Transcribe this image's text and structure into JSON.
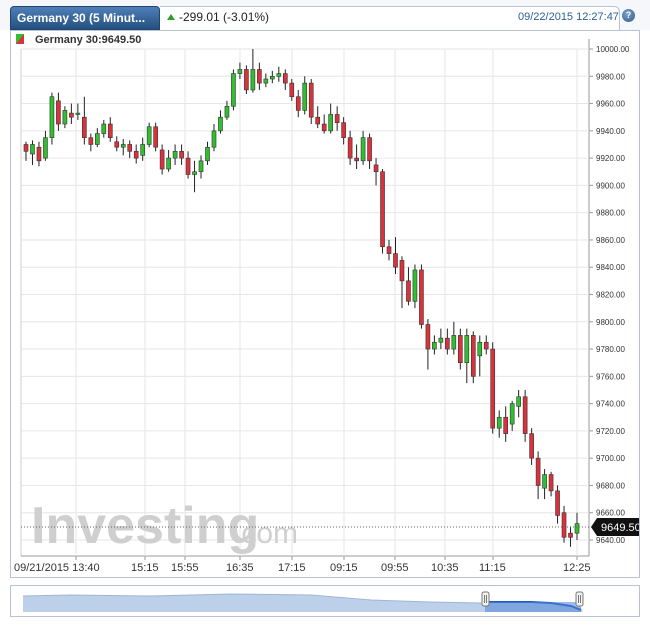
{
  "header": {
    "tab_title": "Germany 30 (5 Minut...",
    "change": "-299.01 (-3.01%)",
    "datetime": "09/22/2015 12:27:47",
    "help_icon": "help-icon"
  },
  "chart": {
    "legend_label": "Germany 30:9649.50",
    "watermark_main": "Investing",
    "watermark_suffix": ".com",
    "last_price_label": "9649.50"
  },
  "colors": {
    "up": "#2fbf2f",
    "down": "#d9323c",
    "tab_bg": "#2d5c8f",
    "grid": "#e6e6e6",
    "nav_fill": "#bcd0ea",
    "nav_line": "#1f5fbf"
  },
  "chart_data": {
    "type": "candlestick",
    "title": "Germany 30 (5 Minut...",
    "ylim": [
      9630,
      10010
    ],
    "y_ticks": [
      "10000.00",
      "9980.00",
      "9960.00",
      "9940.00",
      "9920.00",
      "9900.00",
      "9880.00",
      "9860.00",
      "9840.00",
      "9820.00",
      "9800.00",
      "9780.00",
      "9760.00",
      "9740.00",
      "9720.00",
      "9700.00",
      "9680.00",
      "9660.00",
      "9640.00"
    ],
    "x_ticks": [
      "09/21/2015 13:40",
      "15:15",
      "15:55",
      "16:35",
      "17:15",
      "09:15",
      "09:55",
      "10:35",
      "11:15",
      "12:25"
    ],
    "last_price": 9649.5,
    "candles": [
      [
        9930,
        9925,
        9932,
        9918
      ],
      [
        9923,
        9930,
        9933,
        9915
      ],
      [
        9928,
        9918,
        9932,
        9914
      ],
      [
        9920,
        9935,
        9940,
        9918
      ],
      [
        9935,
        9965,
        9968,
        9930
      ],
      [
        9962,
        9945,
        9968,
        9940
      ],
      [
        9945,
        9955,
        9958,
        9942
      ],
      [
        9953,
        9950,
        9960,
        9945
      ],
      [
        9952,
        9953,
        9960,
        9948
      ],
      [
        9950,
        9935,
        9965,
        9930
      ],
      [
        9935,
        9930,
        9938,
        9925
      ],
      [
        9930,
        9938,
        9942,
        9928
      ],
      [
        9938,
        9945,
        9948,
        9935
      ],
      [
        9945,
        9935,
        9950,
        9932
      ],
      [
        9932,
        9928,
        9936,
        9925
      ],
      [
        9928,
        9930,
        9934,
        9922
      ],
      [
        9930,
        9925,
        9933,
        9920
      ],
      [
        9925,
        9920,
        9930,
        9916
      ],
      [
        9922,
        9930,
        9935,
        9918
      ],
      [
        9930,
        9943,
        9946,
        9928
      ],
      [
        9943,
        9928,
        9946,
        9925
      ],
      [
        9926,
        9912,
        9930,
        9908
      ],
      [
        9912,
        9920,
        9926,
        9910
      ],
      [
        9920,
        9925,
        9930,
        9915
      ],
      [
        9925,
        9920,
        9930,
        9915
      ],
      [
        9920,
        9908,
        9925,
        9905
      ],
      [
        9908,
        9910,
        9918,
        9895
      ],
      [
        9910,
        9918,
        9922,
        9905
      ],
      [
        9918,
        9928,
        9932,
        9915
      ],
      [
        9928,
        9940,
        9945,
        9925
      ],
      [
        9940,
        9950,
        9955,
        9938
      ],
      [
        9950,
        9958,
        9962,
        9948
      ],
      [
        9958,
        9982,
        9985,
        9955
      ],
      [
        9982,
        9985,
        9990,
        9978
      ],
      [
        9985,
        9970,
        9988,
        9967
      ],
      [
        9970,
        9985,
        10000,
        9968
      ],
      [
        9985,
        9975,
        9990,
        9970
      ],
      [
        9975,
        9978,
        9982,
        9972
      ],
      [
        9978,
        9980,
        9984,
        9975
      ],
      [
        9980,
        9982,
        9987,
        9976
      ],
      [
        9982,
        9975,
        9985,
        9970
      ],
      [
        9975,
        9965,
        9978,
        9962
      ],
      [
        9965,
        9955,
        9970,
        9950
      ],
      [
        9955,
        9975,
        9980,
        9952
      ],
      [
        9975,
        9950,
        9978,
        9945
      ],
      [
        9950,
        9945,
        9958,
        9942
      ],
      [
        9945,
        9940,
        9952,
        9938
      ],
      [
        9940,
        9952,
        9960,
        9938
      ],
      [
        9952,
        9946,
        9958,
        9940
      ],
      [
        9946,
        9935,
        9950,
        9930
      ],
      [
        9935,
        9920,
        9940,
        9915
      ],
      [
        9920,
        9918,
        9930,
        9912
      ],
      [
        9918,
        9935,
        9940,
        9915
      ],
      [
        9935,
        9918,
        9938,
        9912
      ],
      [
        9915,
        9910,
        9920,
        9900
      ],
      [
        9910,
        9855,
        9912,
        9850
      ],
      [
        9855,
        9850,
        9860,
        9845
      ],
      [
        9850,
        9840,
        9862,
        9835
      ],
      [
        9845,
        9830,
        9848,
        9810
      ],
      [
        9830,
        9815,
        9840,
        9812
      ],
      [
        9815,
        9838,
        9842,
        9810
      ],
      [
        9838,
        9798,
        9842,
        9795
      ],
      [
        9798,
        9780,
        9802,
        9765
      ],
      [
        9780,
        9785,
        9790,
        9776
      ],
      [
        9785,
        9788,
        9795,
        9780
      ],
      [
        9788,
        9780,
        9795,
        9776
      ],
      [
        9780,
        9790,
        9800,
        9776
      ],
      [
        9790,
        9770,
        9795,
        9765
      ],
      [
        9770,
        9790,
        9795,
        9755
      ],
      [
        9790,
        9760,
        9793,
        9755
      ],
      [
        9775,
        9785,
        9790,
        9760
      ],
      [
        9785,
        9780,
        9790,
        9776
      ],
      [
        9780,
        9722,
        9785,
        9718
      ],
      [
        9722,
        9730,
        9735,
        9715
      ],
      [
        9730,
        9718,
        9738,
        9712
      ],
      [
        9725,
        9740,
        9742,
        9720
      ],
      [
        9738,
        9745,
        9750,
        9730
      ],
      [
        9745,
        9718,
        9750,
        9712
      ],
      [
        9718,
        9700,
        9722,
        9695
      ],
      [
        9700,
        9680,
        9705,
        9670
      ],
      [
        9678,
        9688,
        9692,
        9670
      ],
      [
        9688,
        9676,
        9690,
        9672
      ],
      [
        9676,
        9658,
        9680,
        9652
      ],
      [
        9660,
        9642,
        9665,
        9638
      ],
      [
        9645,
        9642,
        9650,
        9635
      ],
      [
        9645,
        9652,
        9660,
        9640
      ]
    ]
  },
  "navigator": {
    "left_handle": "left-handle",
    "right_handle": "right-handle"
  }
}
